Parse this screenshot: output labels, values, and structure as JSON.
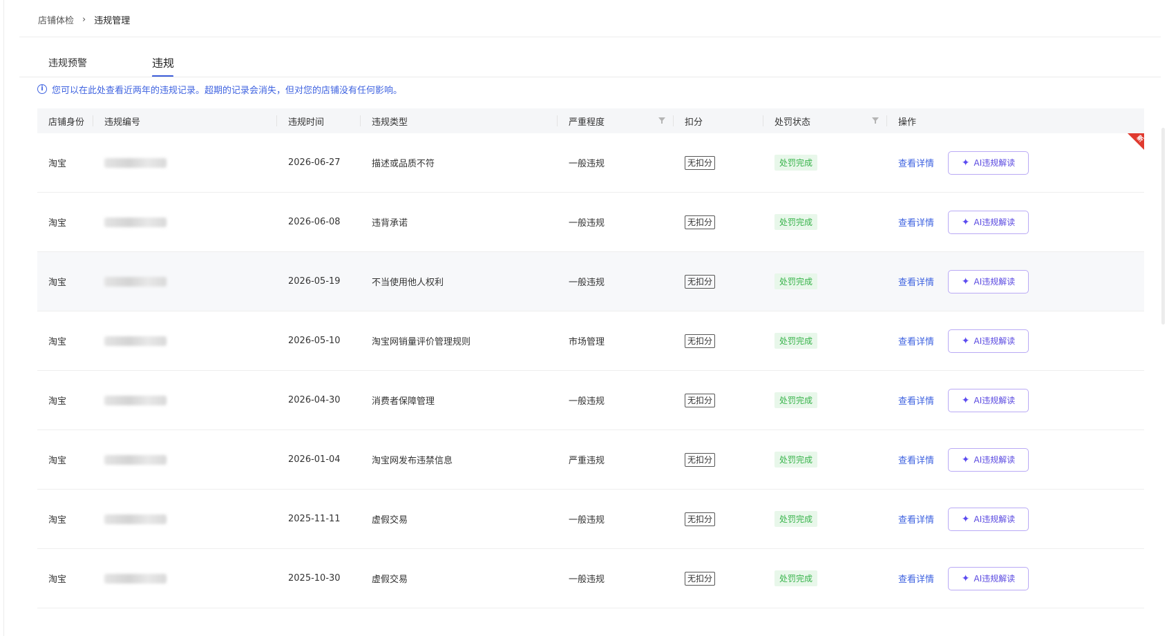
{
  "breadcrumb": {
    "parent": "店铺体检",
    "separator": "›",
    "current": "违规管理"
  },
  "tabs": [
    {
      "label": "违规预警"
    },
    {
      "label": "违规"
    }
  ],
  "notice": {
    "text": "您可以在此处查看近两年的违规记录。超期的记录会消失，但对您的店铺没有任何影响。"
  },
  "table": {
    "headers": {
      "shop_identity": "店铺身份",
      "violation_id": "违规编号",
      "violation_time": "违规时间",
      "violation_type": "违规类型",
      "severity": "严重程度",
      "deduction": "扣分",
      "penalty_status": "处罚状态",
      "actions": "操作"
    },
    "rows": [
      {
        "shop": "淘宝",
        "date": "2026-06-27",
        "type": "描述或品质不符",
        "severity": "一般违规",
        "deduction": "无扣分",
        "status": "处罚完成",
        "detail": "查看详情",
        "ai": "AI违规解读"
      },
      {
        "shop": "淘宝",
        "date": "2026-06-08",
        "type": "违背承诺",
        "severity": "一般违规",
        "deduction": "无扣分",
        "status": "处罚完成",
        "detail": "查看详情",
        "ai": "AI违规解读"
      },
      {
        "shop": "淘宝",
        "date": "2026-05-19",
        "type": "不当使用他人权利",
        "severity": "一般违规",
        "deduction": "无扣分",
        "status": "处罚完成",
        "detail": "查看详情",
        "ai": "AI违规解读"
      },
      {
        "shop": "淘宝",
        "date": "2026-05-10",
        "type": "淘宝网销量评价管理规则",
        "severity": "市场管理",
        "deduction": "无扣分",
        "status": "处罚完成",
        "detail": "查看详情",
        "ai": "AI违规解读"
      },
      {
        "shop": "淘宝",
        "date": "2026-04-30",
        "type": "消费者保障管理",
        "severity": "一般违规",
        "deduction": "无扣分",
        "status": "处罚完成",
        "detail": "查看详情",
        "ai": "AI违规解读"
      },
      {
        "shop": "淘宝",
        "date": "2026-01-04",
        "type": "淘宝网发布违禁信息",
        "severity": "严重违规",
        "deduction": "无扣分",
        "status": "处罚完成",
        "detail": "查看详情",
        "ai": "AI违规解读"
      },
      {
        "shop": "淘宝",
        "date": "2025-11-11",
        "type": "虚假交易",
        "severity": "一般违规",
        "deduction": "无扣分",
        "status": "处罚完成",
        "detail": "查看详情",
        "ai": "AI违规解读"
      },
      {
        "shop": "淘宝",
        "date": "2025-10-30",
        "type": "虚假交易",
        "severity": "一般违规",
        "deduction": "无扣分",
        "status": "处罚完成",
        "detail": "查看详情",
        "ai": "AI违规解读"
      }
    ]
  },
  "badges": {
    "new": "新"
  },
  "colors": {
    "accent": "#3f63e0",
    "status_green": "#37b34a",
    "ai_purple": "#5a49e0",
    "ribbon_red": "#e03a2f"
  },
  "icons": {
    "info": "info-circle-icon",
    "filter": "filter-icon",
    "sparkle": "sparkle-icon",
    "chevron": "chevron-right-icon"
  }
}
